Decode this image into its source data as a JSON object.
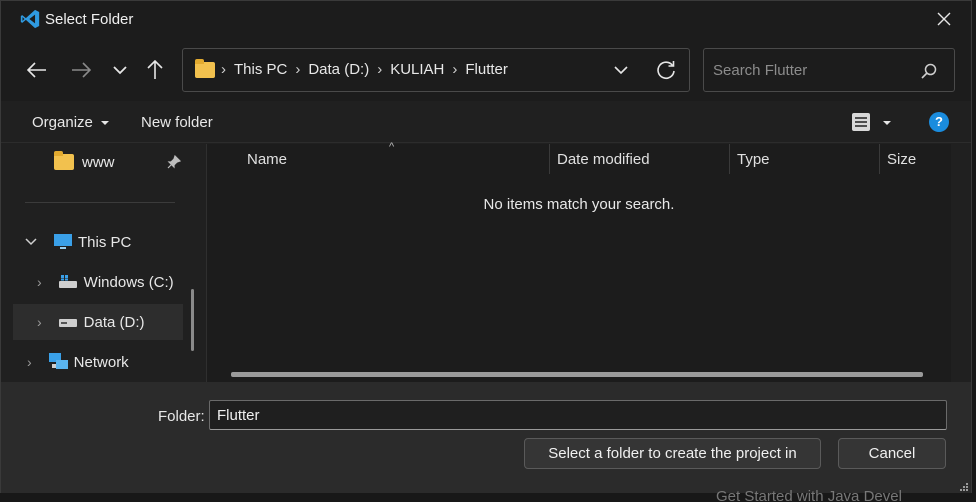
{
  "window": {
    "title": "Select Folder"
  },
  "address": {
    "crumbs": [
      "This PC",
      "Data (D:)",
      "KULIAH",
      "Flutter"
    ]
  },
  "search": {
    "placeholder": "Search Flutter"
  },
  "toolbar": {
    "organize_label": "Organize",
    "new_folder_label": "New folder",
    "help_label": "?"
  },
  "sidebar": {
    "items": [
      {
        "label": "www"
      },
      {
        "label": "This PC"
      },
      {
        "label": "Windows (C:)"
      },
      {
        "label": "Data (D:)"
      },
      {
        "label": "Network"
      }
    ]
  },
  "columns": [
    "Name",
    "Date modified",
    "Type",
    "Size"
  ],
  "empty_message": "No items match your search.",
  "footer": {
    "folder_label": "Folder:",
    "folder_value": "Flutter",
    "select_label": "Select a folder to create the project in",
    "cancel_label": "Cancel"
  },
  "background": {
    "peek_text": "Get Started with Java Devel"
  },
  "colors": {
    "accent": "#1a8cde",
    "folder": "#f2c14e"
  }
}
